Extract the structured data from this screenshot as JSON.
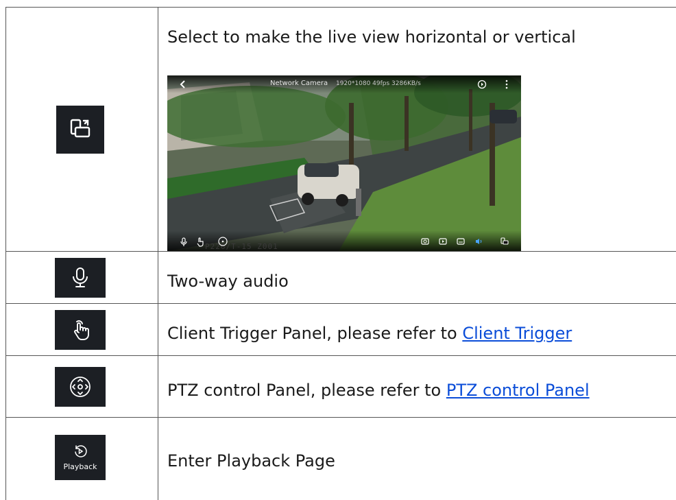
{
  "rows": [
    {
      "icon": "rotate-screen-icon",
      "description": "Select to make the live view horizontal or vertical",
      "live_view": {
        "camera_name": "Network Camera",
        "stream_info": "1920*1080  49fps  3286KB/s",
        "osd_text": "P226/T-15  Z001"
      }
    },
    {
      "icon": "microphone-icon",
      "description": "Two-way audio"
    },
    {
      "icon": "hand-touch-icon",
      "description_prefix": "Client Trigger Panel, please refer to ",
      "link_text": "Client Trigger"
    },
    {
      "icon": "ptz-control-icon",
      "description_prefix": "PTZ control Panel, please refer to ",
      "link_text": "PTZ control Panel"
    },
    {
      "icon": "playback-icon",
      "icon_label": "Playback",
      "description": "Enter Playback Page"
    }
  ],
  "colors": {
    "icon_background": "#1c1f24",
    "link": "#0b4dd8",
    "live_view_accent": "#4aa3ff"
  }
}
